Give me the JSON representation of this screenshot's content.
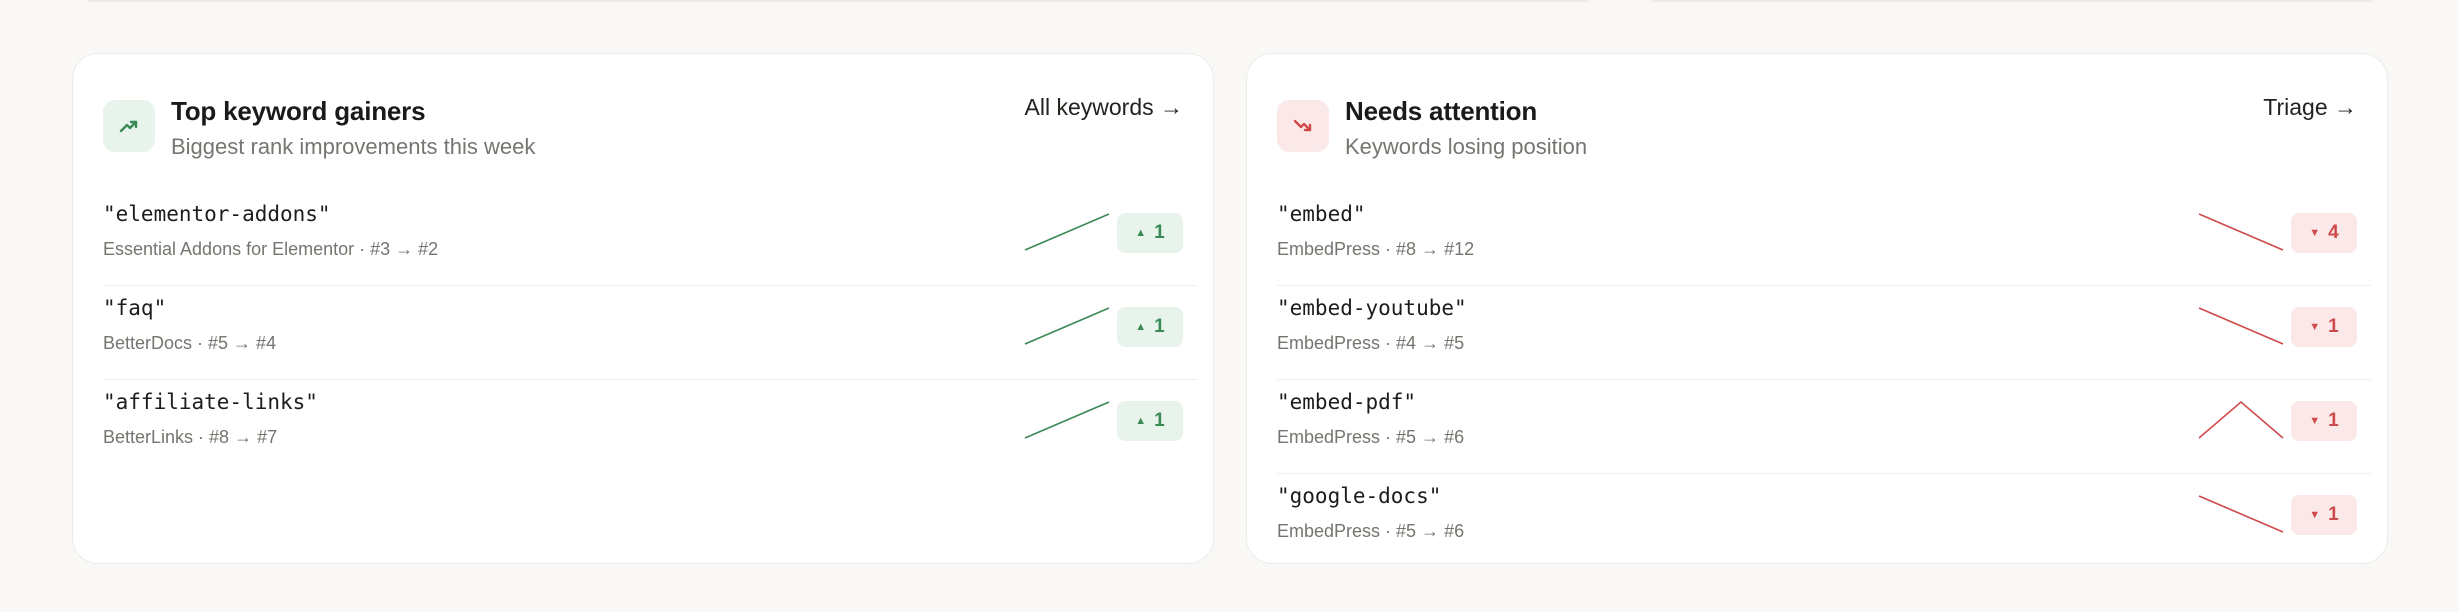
{
  "colors": {
    "gain": "#3a8a55",
    "loss": "#cf4a4a",
    "gain_bg": "#e8f3ec",
    "loss_bg": "#fbe9e9"
  },
  "gainers": {
    "icon": "trending-up-icon",
    "title": "Top keyword gainers",
    "subtitle": "Biggest rank improvements this week",
    "link": "All keywords →",
    "rows": [
      {
        "keyword": "\"elementor-addons\"",
        "meta": "Essential Addons for Elementor · #3 → #2",
        "delta": "1",
        "trend": [
          3,
          2
        ]
      },
      {
        "keyword": "\"faq\"",
        "meta": "BetterDocs · #5 → #4",
        "delta": "1",
        "trend": [
          5,
          4
        ]
      },
      {
        "keyword": "\"affiliate-links\"",
        "meta": "BetterLinks · #8 → #7",
        "delta": "1",
        "trend": [
          8,
          7
        ]
      }
    ]
  },
  "attention": {
    "icon": "trending-down-icon",
    "title": "Needs attention",
    "subtitle": "Keywords losing position",
    "link": "Triage →",
    "rows": [
      {
        "keyword": "\"embed\"",
        "meta": "EmbedPress · #8 → #12",
        "delta": "4",
        "trend": [
          8,
          12
        ]
      },
      {
        "keyword": "\"embed-youtube\"",
        "meta": "EmbedPress · #4 → #5",
        "delta": "1",
        "trend": [
          4,
          5
        ]
      },
      {
        "keyword": "\"embed-pdf\"",
        "meta": "EmbedPress · #5 → #6",
        "delta": "1",
        "trend": [
          6,
          5,
          6
        ]
      },
      {
        "keyword": "\"google-docs\"",
        "meta": "EmbedPress · #5 → #6",
        "delta": "1",
        "trend": [
          5,
          6
        ]
      }
    ]
  }
}
